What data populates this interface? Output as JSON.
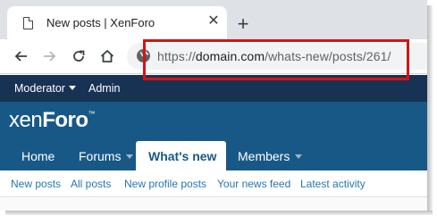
{
  "browser": {
    "tab_title": "New posts | XenForo",
    "tab_close_glyph": "✕",
    "new_tab_glyph": "+",
    "icons": [
      "page-favicon-icon",
      "close-icon",
      "plus-icon",
      "back-arrow-icon",
      "forward-arrow-icon",
      "reload-icon",
      "home-icon",
      "globe-icon"
    ],
    "url": {
      "scheme": "https://",
      "host": "domain.com",
      "path": "/whats-new/posts/261/"
    },
    "highlight_color": "#d41414"
  },
  "forum": {
    "moderator_bar": {
      "moderator_label": "Moderator",
      "admin_label": "Admin"
    },
    "logo": {
      "part1": "xen",
      "part2": "Foro",
      "mark": "™"
    },
    "nav_tabs": [
      {
        "label": "Home"
      },
      {
        "label": "Forums"
      },
      {
        "label": "What's new"
      },
      {
        "label": "Members"
      }
    ],
    "selected_tab": "What's new",
    "sub_nav": [
      {
        "label": "New posts"
      },
      {
        "label": "All posts"
      },
      {
        "label": "New profile posts"
      },
      {
        "label": "Your news feed"
      },
      {
        "label": "Latest activity"
      }
    ],
    "colors": {
      "moderator_bar": "#183254",
      "header": "#185886",
      "link": "#2577b1"
    }
  }
}
